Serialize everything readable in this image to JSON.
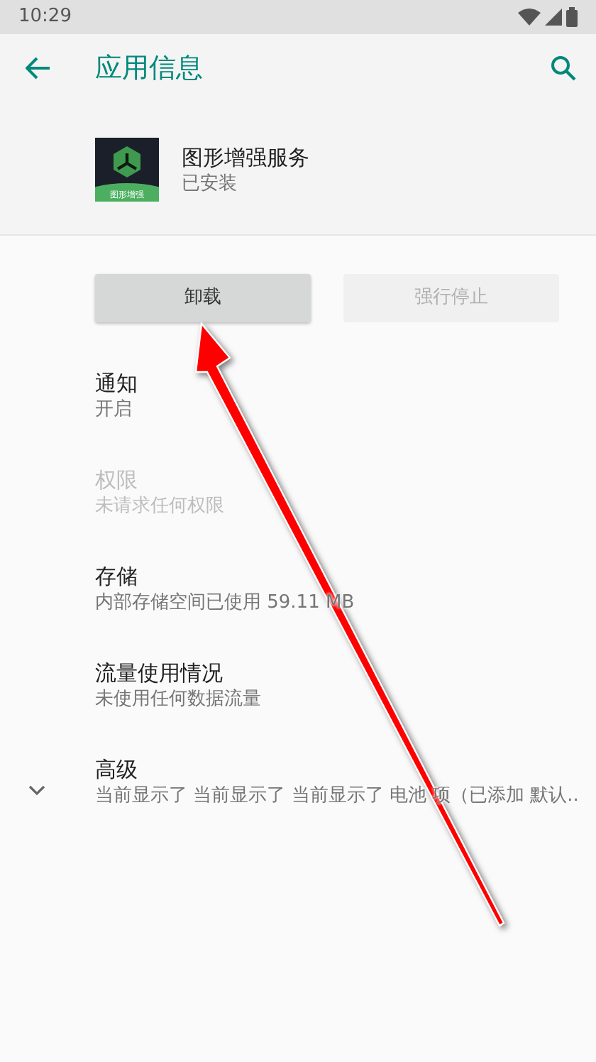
{
  "status_bar": {
    "time": "10:29"
  },
  "toolbar": {
    "title": "应用信息"
  },
  "app": {
    "name": "图形增强服务",
    "status": "已安装",
    "icon_label": "图形增强"
  },
  "buttons": [
    {
      "label": "卸载",
      "disabled": false
    },
    {
      "label": "强行停止",
      "disabled": true
    }
  ],
  "items": [
    {
      "title": "通知",
      "summary": "开启",
      "disabled": false,
      "expandable": false
    },
    {
      "title": "权限",
      "summary": "未请求任何权限",
      "disabled": true,
      "expandable": false
    },
    {
      "title": "存储",
      "summary": "内部存储空间已使用 59.11 MB",
      "disabled": false,
      "expandable": false
    },
    {
      "title": "流量使用情况",
      "summary": "未使用任何数据流量",
      "disabled": false,
      "expandable": false
    },
    {
      "title": "高级",
      "summary": "当前显示了 当前显示了 当前显示了 电池 项（已添加 默认..",
      "disabled": false,
      "expandable": true
    }
  ]
}
